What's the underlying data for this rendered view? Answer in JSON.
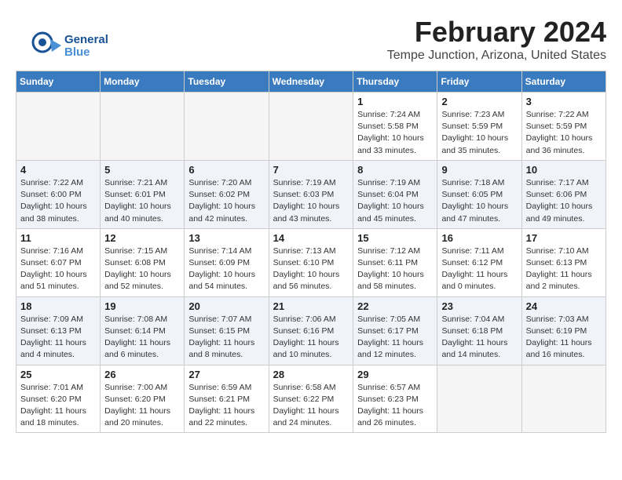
{
  "logo": {
    "text_general": "General",
    "text_blue": "Blue"
  },
  "header": {
    "month_year": "February 2024",
    "location": "Tempe Junction, Arizona, United States"
  },
  "weekdays": [
    "Sunday",
    "Monday",
    "Tuesday",
    "Wednesday",
    "Thursday",
    "Friday",
    "Saturday"
  ],
  "weeks": [
    [
      {
        "day": "",
        "info": ""
      },
      {
        "day": "",
        "info": ""
      },
      {
        "day": "",
        "info": ""
      },
      {
        "day": "",
        "info": ""
      },
      {
        "day": "1",
        "info": "Sunrise: 7:24 AM\nSunset: 5:58 PM\nDaylight: 10 hours\nand 33 minutes."
      },
      {
        "day": "2",
        "info": "Sunrise: 7:23 AM\nSunset: 5:59 PM\nDaylight: 10 hours\nand 35 minutes."
      },
      {
        "day": "3",
        "info": "Sunrise: 7:22 AM\nSunset: 5:59 PM\nDaylight: 10 hours\nand 36 minutes."
      }
    ],
    [
      {
        "day": "4",
        "info": "Sunrise: 7:22 AM\nSunset: 6:00 PM\nDaylight: 10 hours\nand 38 minutes."
      },
      {
        "day": "5",
        "info": "Sunrise: 7:21 AM\nSunset: 6:01 PM\nDaylight: 10 hours\nand 40 minutes."
      },
      {
        "day": "6",
        "info": "Sunrise: 7:20 AM\nSunset: 6:02 PM\nDaylight: 10 hours\nand 42 minutes."
      },
      {
        "day": "7",
        "info": "Sunrise: 7:19 AM\nSunset: 6:03 PM\nDaylight: 10 hours\nand 43 minutes."
      },
      {
        "day": "8",
        "info": "Sunrise: 7:19 AM\nSunset: 6:04 PM\nDaylight: 10 hours\nand 45 minutes."
      },
      {
        "day": "9",
        "info": "Sunrise: 7:18 AM\nSunset: 6:05 PM\nDaylight: 10 hours\nand 47 minutes."
      },
      {
        "day": "10",
        "info": "Sunrise: 7:17 AM\nSunset: 6:06 PM\nDaylight: 10 hours\nand 49 minutes."
      }
    ],
    [
      {
        "day": "11",
        "info": "Sunrise: 7:16 AM\nSunset: 6:07 PM\nDaylight: 10 hours\nand 51 minutes."
      },
      {
        "day": "12",
        "info": "Sunrise: 7:15 AM\nSunset: 6:08 PM\nDaylight: 10 hours\nand 52 minutes."
      },
      {
        "day": "13",
        "info": "Sunrise: 7:14 AM\nSunset: 6:09 PM\nDaylight: 10 hours\nand 54 minutes."
      },
      {
        "day": "14",
        "info": "Sunrise: 7:13 AM\nSunset: 6:10 PM\nDaylight: 10 hours\nand 56 minutes."
      },
      {
        "day": "15",
        "info": "Sunrise: 7:12 AM\nSunset: 6:11 PM\nDaylight: 10 hours\nand 58 minutes."
      },
      {
        "day": "16",
        "info": "Sunrise: 7:11 AM\nSunset: 6:12 PM\nDaylight: 11 hours\nand 0 minutes."
      },
      {
        "day": "17",
        "info": "Sunrise: 7:10 AM\nSunset: 6:13 PM\nDaylight: 11 hours\nand 2 minutes."
      }
    ],
    [
      {
        "day": "18",
        "info": "Sunrise: 7:09 AM\nSunset: 6:13 PM\nDaylight: 11 hours\nand 4 minutes."
      },
      {
        "day": "19",
        "info": "Sunrise: 7:08 AM\nSunset: 6:14 PM\nDaylight: 11 hours\nand 6 minutes."
      },
      {
        "day": "20",
        "info": "Sunrise: 7:07 AM\nSunset: 6:15 PM\nDaylight: 11 hours\nand 8 minutes."
      },
      {
        "day": "21",
        "info": "Sunrise: 7:06 AM\nSunset: 6:16 PM\nDaylight: 11 hours\nand 10 minutes."
      },
      {
        "day": "22",
        "info": "Sunrise: 7:05 AM\nSunset: 6:17 PM\nDaylight: 11 hours\nand 12 minutes."
      },
      {
        "day": "23",
        "info": "Sunrise: 7:04 AM\nSunset: 6:18 PM\nDaylight: 11 hours\nand 14 minutes."
      },
      {
        "day": "24",
        "info": "Sunrise: 7:03 AM\nSunset: 6:19 PM\nDaylight: 11 hours\nand 16 minutes."
      }
    ],
    [
      {
        "day": "25",
        "info": "Sunrise: 7:01 AM\nSunset: 6:20 PM\nDaylight: 11 hours\nand 18 minutes."
      },
      {
        "day": "26",
        "info": "Sunrise: 7:00 AM\nSunset: 6:20 PM\nDaylight: 11 hours\nand 20 minutes."
      },
      {
        "day": "27",
        "info": "Sunrise: 6:59 AM\nSunset: 6:21 PM\nDaylight: 11 hours\nand 22 minutes."
      },
      {
        "day": "28",
        "info": "Sunrise: 6:58 AM\nSunset: 6:22 PM\nDaylight: 11 hours\nand 24 minutes."
      },
      {
        "day": "29",
        "info": "Sunrise: 6:57 AM\nSunset: 6:23 PM\nDaylight: 11 hours\nand 26 minutes."
      },
      {
        "day": "",
        "info": ""
      },
      {
        "day": "",
        "info": ""
      }
    ]
  ]
}
